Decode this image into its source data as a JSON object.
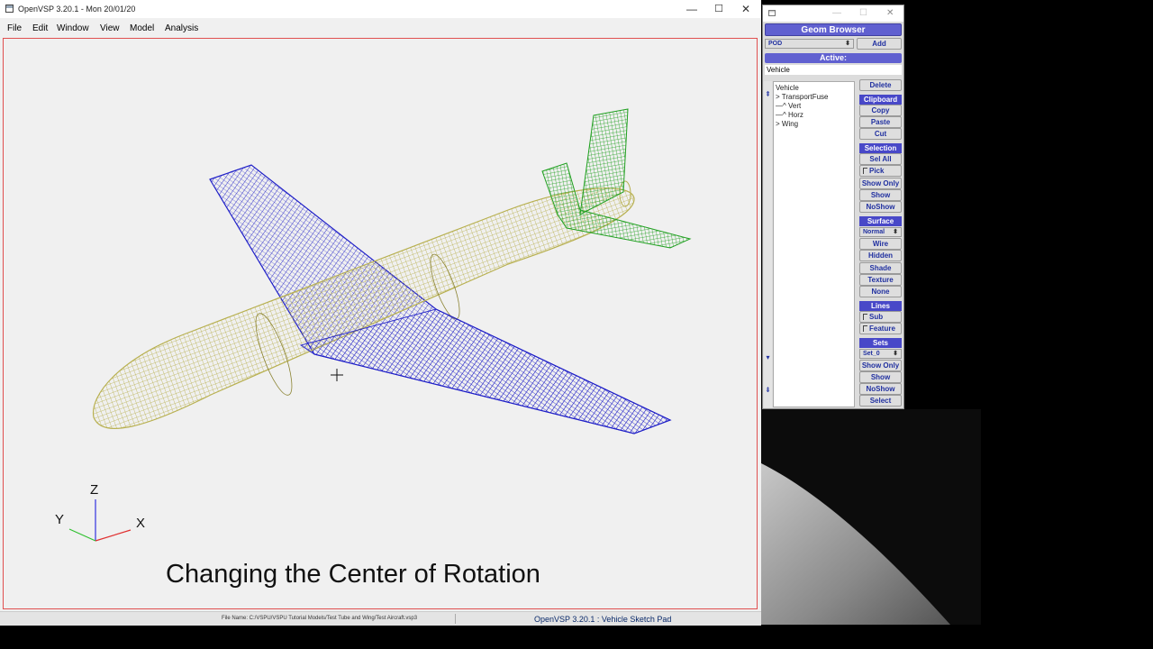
{
  "main_window": {
    "title": "OpenVSP 3.20.1 - Mon 20/01/20",
    "controls": {
      "minimize": "—",
      "maximize": "☐",
      "close": "✕"
    },
    "menu": [
      "File",
      "Edit",
      "Window",
      "View",
      "Model",
      "Analysis"
    ]
  },
  "viewport": {
    "subtitle": "Changing the Center of Rotation",
    "axes": {
      "z": "Z",
      "y": "Y",
      "x": "X"
    }
  },
  "status": {
    "file_name": "File Name: C:/VSPU/VSPU Tutorial Models/Test Tube and Wing/Test Aircraft.vsp3",
    "app": "OpenVSP 3.20.1 : Vehicle Sketch Pad"
  },
  "geom_browser": {
    "title": "Geom Browser",
    "type_select": "POD",
    "add_label": "Add",
    "active_header": "Active:",
    "active_value": "Vehicle",
    "tree": [
      {
        "label": "Vehicle"
      },
      {
        "label": "> TransportFuse"
      },
      {
        "label": "—^ Vert"
      },
      {
        "label": "—^ Horz"
      },
      {
        "label": "> Wing"
      }
    ],
    "delete_label": "Delete",
    "clipboard": {
      "header": "Clipboard",
      "copy": "Copy",
      "paste": "Paste",
      "cut": "Cut"
    },
    "selection": {
      "header": "Selection",
      "sel_all": "Sel All",
      "pick": "Pick",
      "show_only": "Show Only",
      "show": "Show",
      "noshow": "NoShow"
    },
    "surface": {
      "header": "Surface",
      "mode": "Normal",
      "wire": "Wire",
      "hidden": "Hidden",
      "shade": "Shade",
      "texture": "Texture",
      "none": "None"
    },
    "lines": {
      "header": "Lines",
      "sub": "Sub",
      "feature": "Feature"
    },
    "sets": {
      "header": "Sets",
      "set": "Set_0",
      "show_only": "Show Only",
      "show": "Show",
      "noshow": "NoShow",
      "select": "Select"
    }
  },
  "colors": {
    "fuselage": "#b8b050",
    "wing": "#2020c8",
    "tail": "#20a020",
    "header": "#5050d0",
    "button_text": "#2030a0"
  }
}
